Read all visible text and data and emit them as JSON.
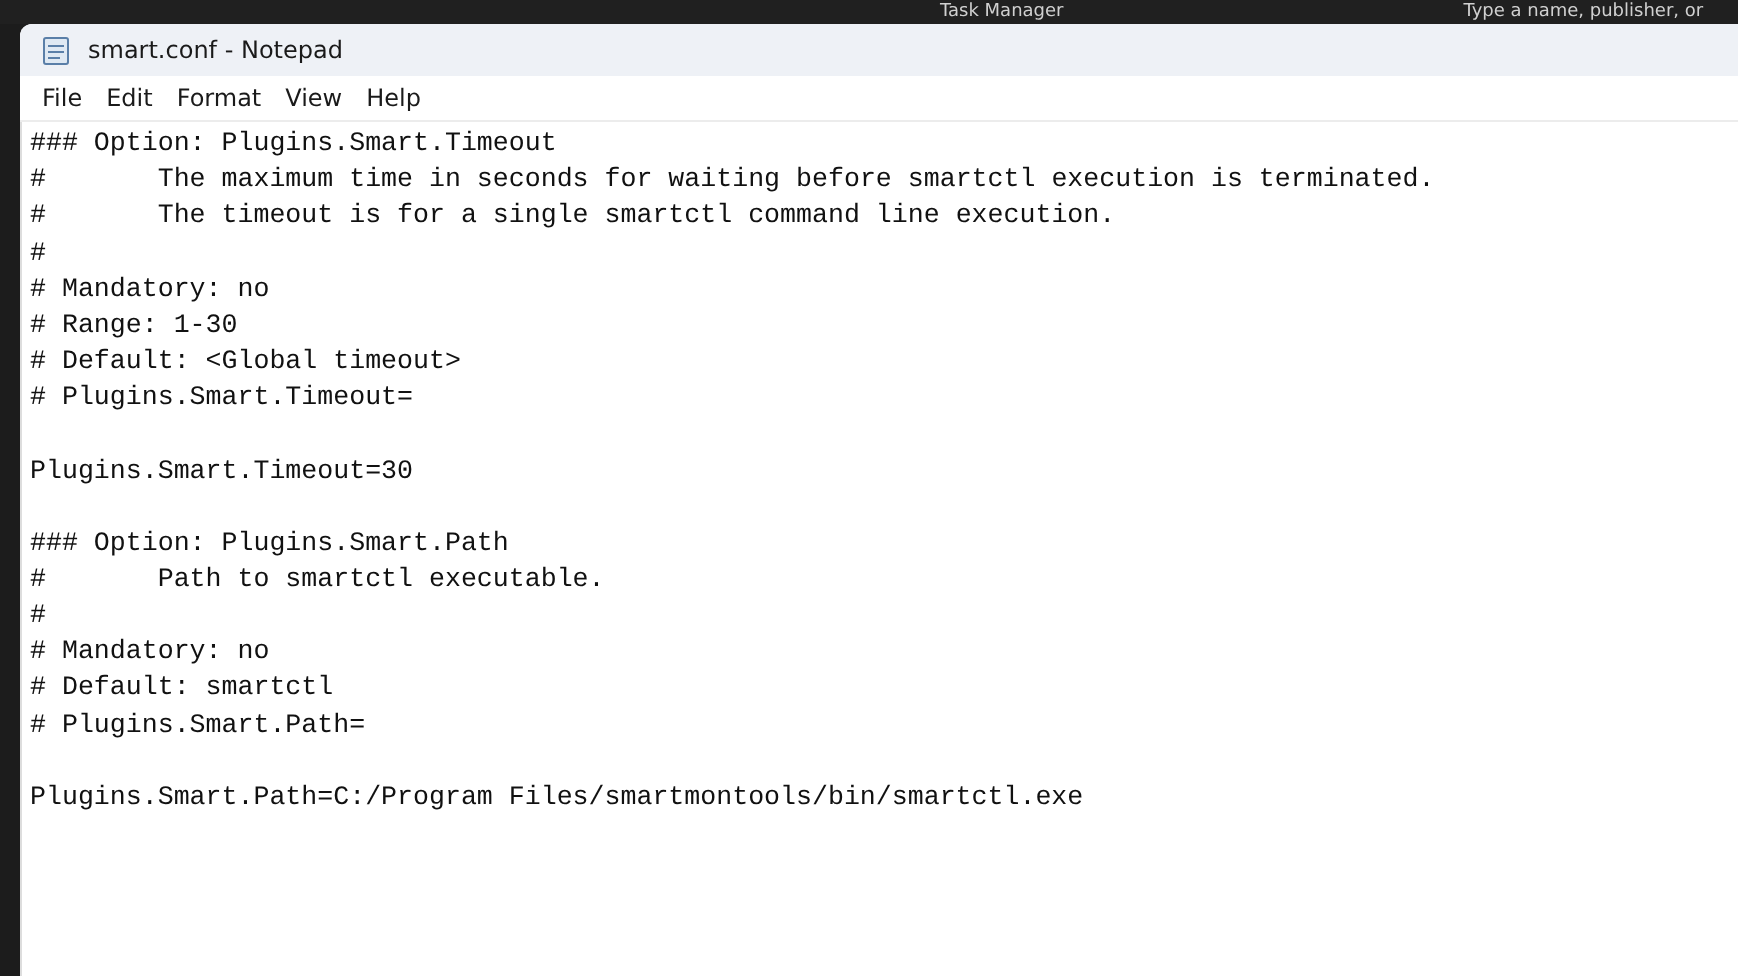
{
  "background": {
    "app_label": "Task Manager",
    "search_placeholder": "Type a name, publisher, or"
  },
  "window": {
    "title": "smart.conf - Notepad"
  },
  "menu": [
    "File",
    "Edit",
    "Format",
    "View",
    "Help"
  ],
  "document": [
    [
      "### Option: Plugins.Smart.Timeout",
      "#\tThe maximum time in seconds for waiting before smartctl execution is terminated.",
      "#\tThe timeout is for a single smartctl command line execution.",
      "#",
      "# Mandatory: no",
      "# Range: 1-30",
      "# Default: <Global timeout>",
      "# Plugins.Smart.Timeout="
    ],
    [
      "Plugins.Smart.Timeout=30"
    ],
    [
      "### Option: Plugins.Smart.Path",
      "#\tPath to smartctl executable.",
      "#",
      "# Mandatory: no",
      "# Default: smartctl",
      "# Plugins.Smart.Path="
    ],
    [
      "Plugins.Smart.Path=C:/Program Files/smartmontools/bin/smartctl.exe"
    ]
  ]
}
